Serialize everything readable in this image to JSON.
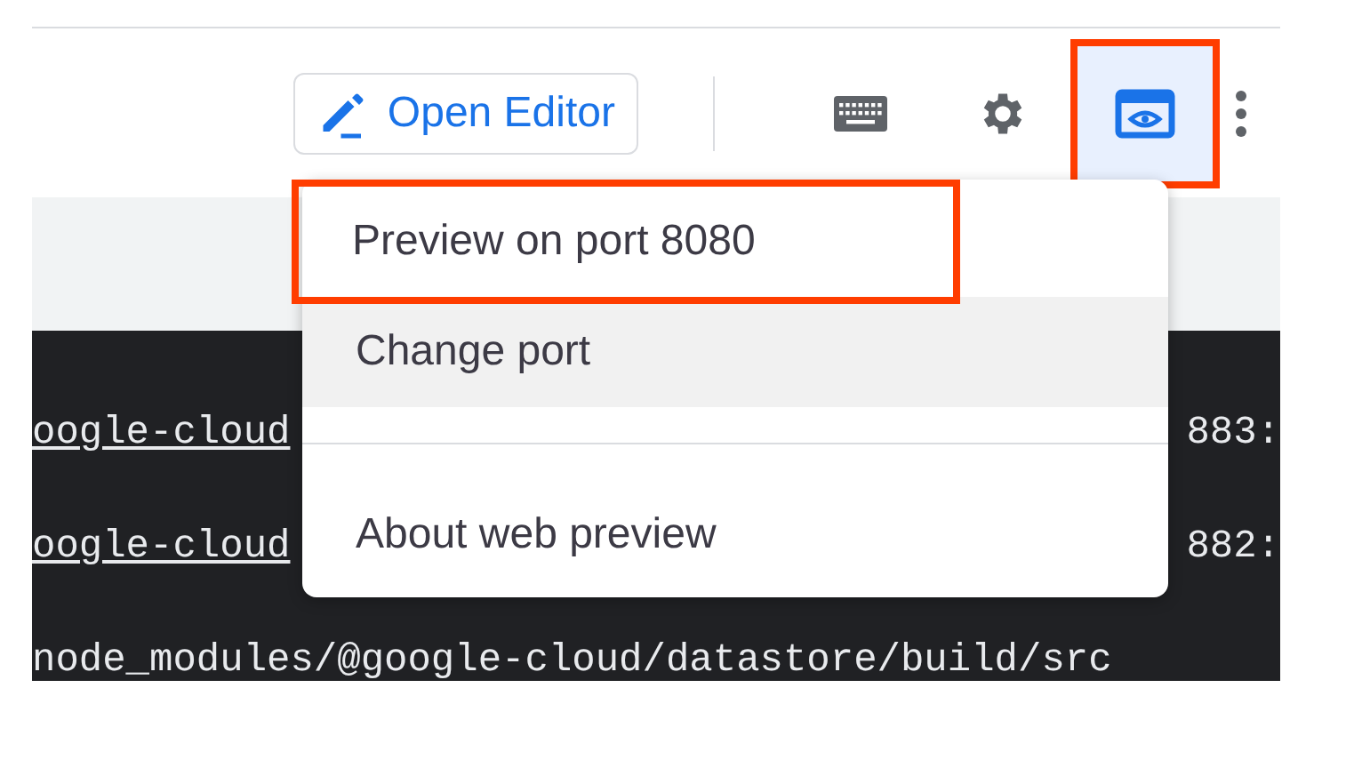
{
  "toolbar": {
    "open_editor": {
      "label": "Open Editor"
    },
    "buttons": [
      {
        "kind": "keyboard",
        "active": false,
        "annotated": false
      },
      {
        "kind": "settings",
        "active": false,
        "annotated": false
      },
      {
        "kind": "web-preview",
        "active": true,
        "annotated": true
      },
      {
        "kind": "more",
        "active": false,
        "annotated": false
      }
    ]
  },
  "terminal": {
    "lines": [
      {
        "left": "oogle-cloud",
        "right": "883:",
        "underlined": true
      },
      {
        "left": "oogle-cloud",
        "right": "882:",
        "underlined": true
      },
      {
        "left": "node_modules/@google-cloud/datastore/build/src",
        "underlined": false
      }
    ]
  },
  "menu": {
    "items": [
      {
        "label": "Preview on port 8080",
        "highlighted": false,
        "annotated": true,
        "divider_after": false
      },
      {
        "label": "Change port",
        "highlighted": true,
        "annotated": false,
        "divider_after": true
      },
      {
        "label": "About web preview",
        "highlighted": false,
        "annotated": false,
        "divider_after": false
      }
    ]
  }
}
